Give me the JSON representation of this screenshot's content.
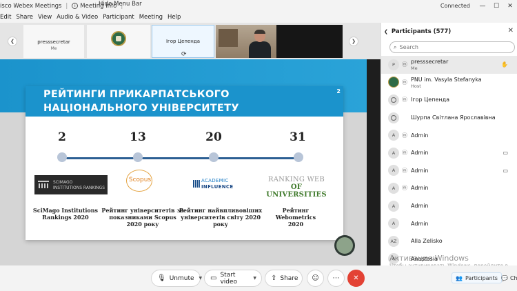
{
  "window": {
    "app_title": "isco Webex Meetings",
    "meeting_info": "Meeting Info",
    "hide_menu_bar": "Hide Menu Bar",
    "status": "Connected"
  },
  "menu": [
    "Edit",
    "Share",
    "View",
    "Audio & Video",
    "Participant",
    "Meeting",
    "Help"
  ],
  "strip": {
    "tiles": [
      {
        "name": "presssecretar",
        "sub": "Me"
      },
      {
        "name": "Ігор Цепенда",
        "sub": ""
      }
    ]
  },
  "slide": {
    "title_line1": "РЕЙТИНГИ ПРИКАРПАТСЬКОГО",
    "title_line2": "НАЦІОНАЛЬНОГО УНІВЕРСИТЕТУ",
    "page_number": "2",
    "ranks": [
      "2",
      "13",
      "20",
      "31"
    ],
    "logos": {
      "scimago_line1": "SCIMAGO",
      "scimago_line2": "INSTITUTIONS RANKINGS",
      "scopus": "Scopus",
      "academic_line1": "ACADEMIC",
      "academic_line2": "INFLUENCE",
      "ranking_line1": "RANKING WEB",
      "ranking_line2": "OF UNIVERSITIES"
    },
    "captions": [
      "SciMago Institutions Rankings 2020",
      "Рейтинг університетів за показниками Scopus 2020 року",
      "Рейтинг найвпливовіших університетів світу 2020 року",
      "Рейтинг Webometrics 2020"
    ]
  },
  "toolbar": {
    "unmute": "Unmute",
    "start_video": "Start video",
    "share": "Share",
    "participants": "Participants",
    "chat": "Ch"
  },
  "panel": {
    "title": "Participants (577)",
    "search_placeholder": "Search",
    "participants": [
      {
        "initial": "P",
        "name": "presssecretar",
        "sub": "Me",
        "right_icon": "hand-icon"
      },
      {
        "initial": "",
        "name": "PNU im. Vasyla Stefanyka",
        "sub": "Host",
        "right_icon": ""
      },
      {
        "initial": "",
        "name": "Ігор Цепенда",
        "sub": "",
        "right_icon": ""
      },
      {
        "initial": "",
        "name": "Шурпа Світлана Ярославівна",
        "sub": "",
        "right_icon": ""
      },
      {
        "initial": "A",
        "name": "Admin",
        "sub": "",
        "right_icon": ""
      },
      {
        "initial": "A",
        "name": "Admin",
        "sub": "",
        "right_icon": "video-icon"
      },
      {
        "initial": "A",
        "name": "Admin",
        "sub": "",
        "right_icon": "video-icon"
      },
      {
        "initial": "A",
        "name": "Admin",
        "sub": "",
        "right_icon": ""
      },
      {
        "initial": "A",
        "name": "Admin",
        "sub": "",
        "right_icon": ""
      },
      {
        "initial": "A",
        "name": "Admin",
        "sub": "",
        "right_icon": ""
      },
      {
        "initial": "AZ",
        "name": "Alla Zelisko",
        "sub": "",
        "right_icon": ""
      },
      {
        "initial": "A",
        "name": "Anastasia",
        "sub": "",
        "right_icon": ""
      }
    ]
  },
  "watermark": {
    "line1": "Активация Windows",
    "line2": "Чтобы активировать Windows, перейдите в раздел \"Параметры\"."
  }
}
